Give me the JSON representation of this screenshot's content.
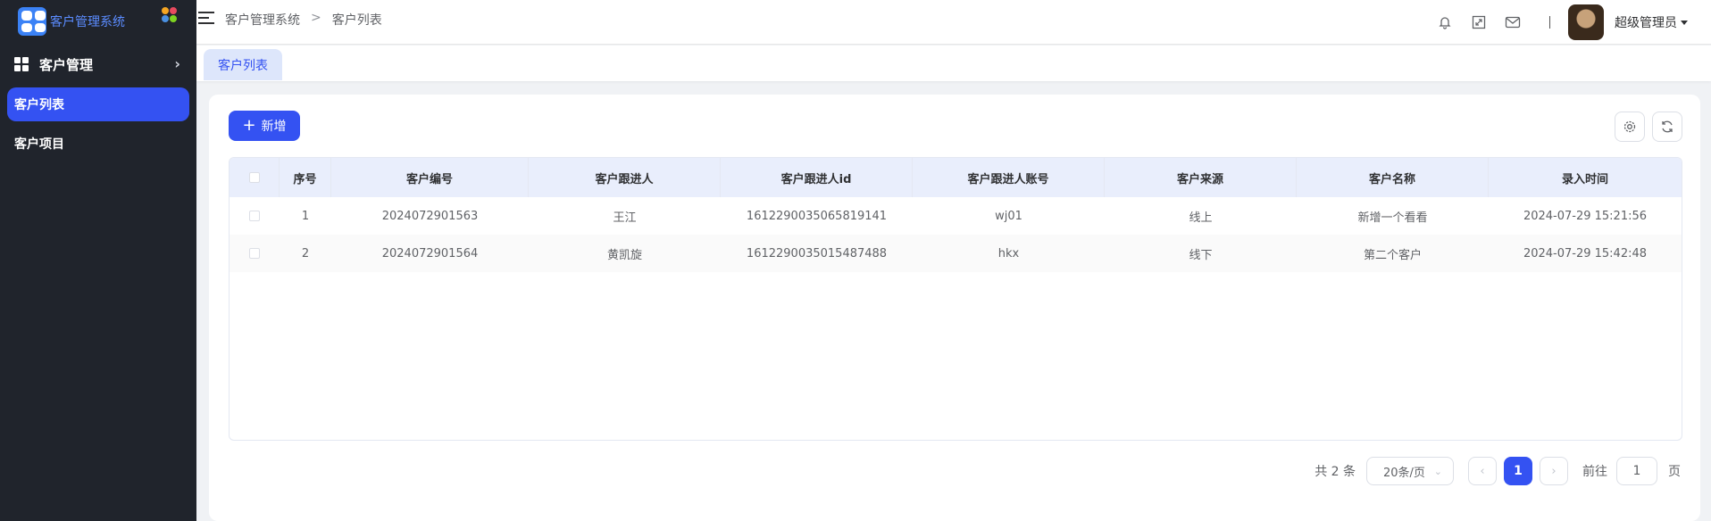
{
  "app": {
    "title": "客户管理系统",
    "accent": "#3452f2"
  },
  "sidebar": {
    "parent": {
      "label": "客户管理",
      "icon": "grid-icon"
    },
    "items": [
      {
        "label": "客户列表",
        "active": true
      },
      {
        "label": "客户项目",
        "active": false
      }
    ]
  },
  "header": {
    "breadcrumb": [
      "客户管理系统",
      ">",
      "客户列表"
    ],
    "user_name": "超级管理员"
  },
  "tabs": [
    {
      "label": "客户列表"
    }
  ],
  "toolbar": {
    "add_label": "新增"
  },
  "table": {
    "headers": [
      "",
      "序号",
      "客户编号",
      "客户跟进人",
      "客户跟进人id",
      "客户跟进人账号",
      "客户来源",
      "客户名称",
      "录入时间"
    ],
    "rows": [
      [
        "1",
        "2024072901563",
        "王江",
        "1612290035065819141",
        "wj01",
        "线上",
        "新增一个看看",
        "2024-07-29 15:21:56"
      ],
      [
        "2",
        "2024072901564",
        "黄凯旋",
        "1612290035015487488",
        "hkx",
        "线下",
        "第二个客户",
        "2024-07-29 15:42:48"
      ]
    ]
  },
  "pagination": {
    "total_text": "共 2 条",
    "page_size": "20条/页",
    "current_page": "1",
    "goto_label": "前往",
    "goto_value": "1",
    "page_suffix": "页"
  }
}
